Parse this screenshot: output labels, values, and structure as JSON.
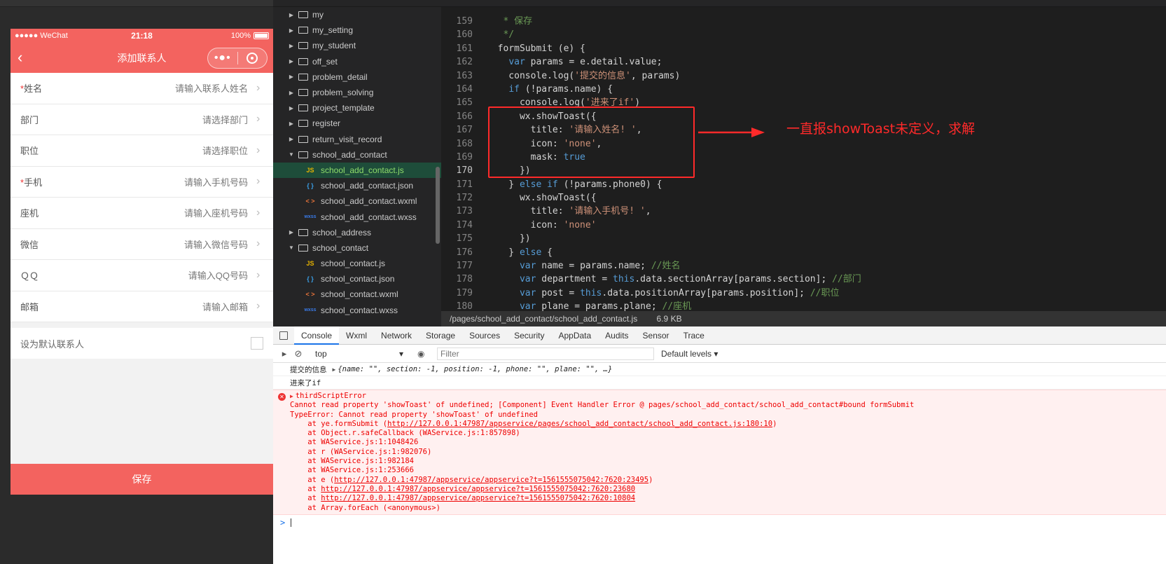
{
  "phone": {
    "status": {
      "carrier": "●●●●● WeChat",
      "time": "21:18",
      "battery": "100%"
    },
    "nav_title": "添加联系人",
    "capsule_more": "•●•",
    "fields": [
      {
        "required": "*",
        "label": "姓名",
        "placeholder": "请输入联系人姓名"
      },
      {
        "required": "",
        "label": "部门",
        "placeholder": "请选择部门"
      },
      {
        "required": "",
        "label": "职位",
        "placeholder": "请选择职位"
      },
      {
        "required": "*",
        "label": "手机",
        "placeholder": "请输入手机号码"
      },
      {
        "required": "",
        "label": "座机",
        "placeholder": "请输入座机号码"
      },
      {
        "required": "",
        "label": "微信",
        "placeholder": "请输入微信号码"
      },
      {
        "required": "",
        "label": "ＱＱ",
        "placeholder": "请输入QQ号码"
      },
      {
        "required": "",
        "label": "邮箱",
        "placeholder": "请输入邮箱"
      }
    ],
    "default_label": "设为默认联系人",
    "save_label": "保存",
    "accent": "#f3635f"
  },
  "file_tree": [
    {
      "type": "folder",
      "open": false,
      "name": "my"
    },
    {
      "type": "folder",
      "open": false,
      "name": "my_setting"
    },
    {
      "type": "folder",
      "open": false,
      "name": "my_student"
    },
    {
      "type": "folder",
      "open": false,
      "name": "off_set"
    },
    {
      "type": "folder",
      "open": false,
      "name": "problem_detail"
    },
    {
      "type": "folder",
      "open": false,
      "name": "problem_solving"
    },
    {
      "type": "folder",
      "open": false,
      "name": "project_template"
    },
    {
      "type": "folder",
      "open": false,
      "name": "register"
    },
    {
      "type": "folder",
      "open": false,
      "name": "return_visit_record"
    },
    {
      "type": "folder",
      "open": true,
      "name": "school_add_contact"
    },
    {
      "type": "js",
      "name": "school_add_contact.js",
      "active": true
    },
    {
      "type": "json",
      "name": "school_add_contact.json"
    },
    {
      "type": "wxml",
      "name": "school_add_contact.wxml"
    },
    {
      "type": "wxss",
      "name": "school_add_contact.wxss"
    },
    {
      "type": "folder",
      "open": false,
      "name": "school_address"
    },
    {
      "type": "folder",
      "open": true,
      "name": "school_contact"
    },
    {
      "type": "js",
      "name": "school_contact.js"
    },
    {
      "type": "json",
      "name": "school_contact.json"
    },
    {
      "type": "wxml",
      "name": "school_contact.wxml"
    },
    {
      "type": "wxss",
      "name": "school_contact.wxss"
    }
  ],
  "file_icons": {
    "js": "JS",
    "json": "{ }",
    "wxml": "< >",
    "wxss": "wxss"
  },
  "code": {
    "current_line": 170,
    "lines": [
      {
        "n": "159",
        "html": "<span class='cmt'> * 保存</span>"
      },
      {
        "n": "160",
        "html": "<span class='cmt'> */</span>"
      },
      {
        "n": "161",
        "html": "formSubmit (e) {"
      },
      {
        "n": "162",
        "html": "  <span class='kw'>var</span> params = e.detail.value;"
      },
      {
        "n": "163",
        "html": "  console.log(<span class='str'>'提交的信息'</span>, params)"
      },
      {
        "n": "164",
        "html": "  <span class='kw'>if</span> (!params.name) {"
      },
      {
        "n": "165",
        "html": "    console.log(<span class='str'>'进来了if'</span>)"
      },
      {
        "n": "166",
        "html": "    wx.showToast({"
      },
      {
        "n": "167",
        "html": "      title: <span class='str'>'请输入姓名! '</span>,"
      },
      {
        "n": "168",
        "html": "      icon: <span class='str'>'none'</span>,"
      },
      {
        "n": "169",
        "html": "      mask: <span class='kw'>true</span>"
      },
      {
        "n": "170",
        "html": "    })"
      },
      {
        "n": "171",
        "html": "  } <span class='kw'>else if</span> (!params.phone0) {"
      },
      {
        "n": "172",
        "html": "    wx.showToast({"
      },
      {
        "n": "173",
        "html": "      title: <span class='str'>'请输入手机号! '</span>,"
      },
      {
        "n": "174",
        "html": "      icon: <span class='str'>'none'</span>"
      },
      {
        "n": "175",
        "html": "    })"
      },
      {
        "n": "176",
        "html": "  } <span class='kw'>else</span> {"
      },
      {
        "n": "177",
        "html": "    <span class='kw'>var</span> name = params.name; <span class='cmt'>//姓名</span>"
      },
      {
        "n": "178",
        "html": "    <span class='kw'>var</span> department = <span class='kw'>this</span>.data.sectionArray[params.section]; <span class='cmt'>//部门</span>"
      },
      {
        "n": "179",
        "html": "    <span class='kw'>var</span> post = <span class='kw'>this</span>.data.positionArray[params.position]; <span class='cmt'>//职位</span>"
      },
      {
        "n": "180",
        "html": "    <span class='kw'>var</span> plane = params.plane; <span class='cmt'>//座机</span>"
      }
    ]
  },
  "annotation": {
    "text": "一直报showToast未定义，求解",
    "color": "#ff2a2a"
  },
  "editor_status": {
    "path": "/pages/school_add_contact/school_add_contact.js",
    "size": "6.9 KB"
  },
  "devtools": {
    "tabs": [
      "Console",
      "Wxml",
      "Network",
      "Storage",
      "Sources",
      "Security",
      "AppData",
      "Audits",
      "Sensor",
      "Trace"
    ],
    "active_tab": "Console",
    "context": "top",
    "filter_placeholder": "Filter",
    "levels": "Default levels ▾",
    "logs": [
      {
        "text": "提交的信息",
        "obj": "{name: \"\", section: -1, position: -1, phone: \"\", plane: \"\", …}"
      },
      {
        "text": "进来了if",
        "obj": ""
      }
    ],
    "error": {
      "title": "thirdScriptError",
      "message": "Cannot read property 'showToast' of undefined; [Component] Event Handler Error @ pages/school_add_contact/school_add_contact#bound formSubmit",
      "type_line": "TypeError: Cannot read property 'showToast' of undefined",
      "stack": [
        {
          "pre": "    at ye.formSubmit (",
          "link": "http://127.0.0.1:47987/appservice/pages/school_add_contact/school_add_contact.js:180:10",
          "post": ")"
        },
        {
          "pre": "    at Object.r.safeCallback (WAService.js:1:857898)",
          "link": "",
          "post": ""
        },
        {
          "pre": "    at WAService.js:1:1048426",
          "link": "",
          "post": ""
        },
        {
          "pre": "    at r (WAService.js:1:982076)",
          "link": "",
          "post": ""
        },
        {
          "pre": "    at WAService.js:1:982184",
          "link": "",
          "post": ""
        },
        {
          "pre": "    at WAService.js:1:253666",
          "link": "",
          "post": ""
        },
        {
          "pre": "    at e (",
          "link": "http://127.0.0.1:47987/appservice/appservice?t=1561555075042:7620:23495",
          "post": ")"
        },
        {
          "pre": "    at ",
          "link": "http://127.0.0.1:47987/appservice/appservice?t=1561555075042:7620:23680",
          "post": ""
        },
        {
          "pre": "    at ",
          "link": "http://127.0.0.1:47987/appservice/appservice?t=1561555075042:7620:10804",
          "post": ""
        },
        {
          "pre": "    at Array.forEach (<anonymous>)",
          "link": "",
          "post": ""
        }
      ]
    },
    "prompt": ">"
  }
}
